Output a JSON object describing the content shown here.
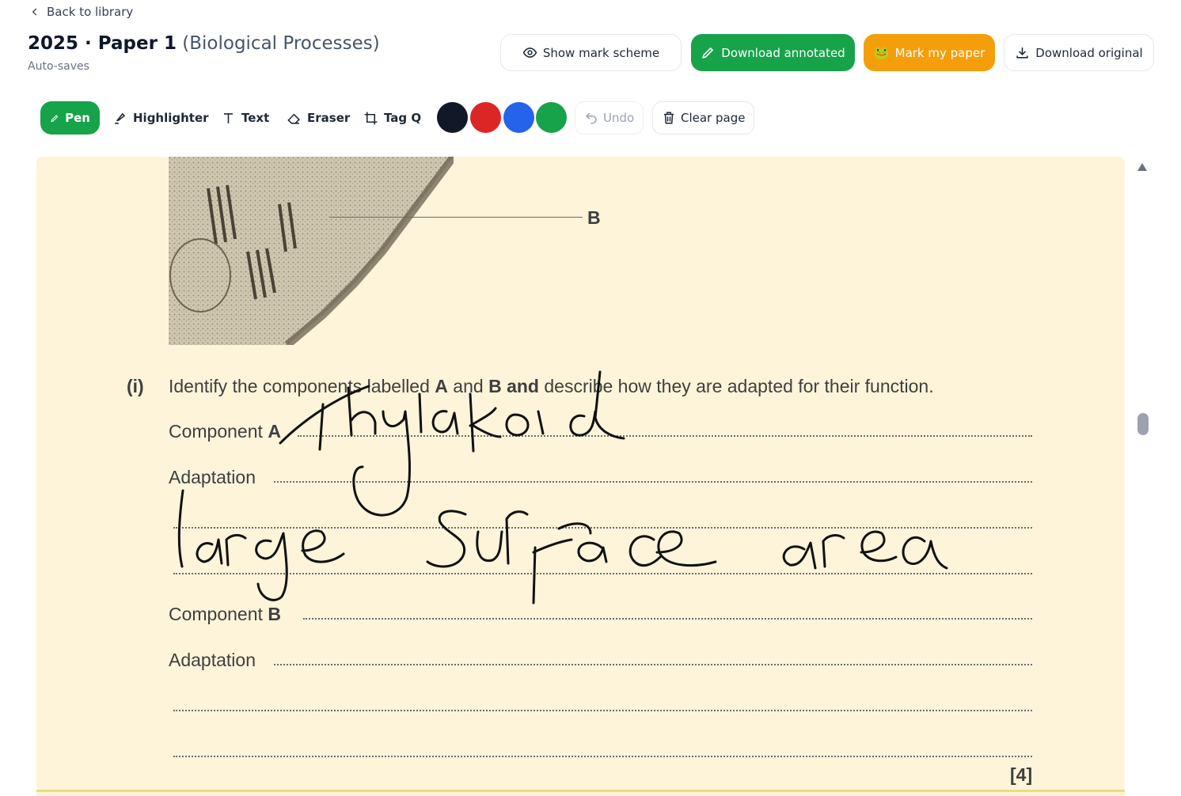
{
  "nav": {
    "back_label": "Back to library"
  },
  "header": {
    "title_main": "2025 · Paper 1",
    "title_sub": "(Biological Processes)",
    "autosave": "Auto-saves"
  },
  "actions": {
    "show_mark_scheme": "Show mark scheme",
    "download_annotated": "Download annotated",
    "mark_my_paper": "Mark my paper",
    "mark_my_paper_icon": "🐸",
    "download_original": "Download original"
  },
  "toolbar": {
    "pen": "Pen",
    "highlighter": "Highlighter",
    "text": "Text",
    "eraser": "Eraser",
    "tag_q": "Tag Q",
    "colors": [
      "#111827",
      "#dc2626",
      "#2563eb",
      "#16a34a"
    ],
    "undo": "Undo",
    "clear_page": "Clear page"
  },
  "paper": {
    "label_b": "B",
    "question_number": "(i)",
    "q_part1": "Identify the components labelled ",
    "q_bold_a": "A",
    "q_part2": " and ",
    "q_bold_b": "B",
    "q_bold_and": "and",
    "q_part3": " describe how they are adapted for their function.",
    "component_a_label": "Component ",
    "component_a_letter": "A",
    "adaptation_a_label": "Adaptation",
    "component_b_label": "Component ",
    "component_b_letter": "B",
    "adaptation_b_label": "Adaptation",
    "marks": "[4]"
  },
  "handwriting": {
    "line1": "Thylakoid",
    "line2": "large surface area",
    "ink_color": "#111111"
  }
}
